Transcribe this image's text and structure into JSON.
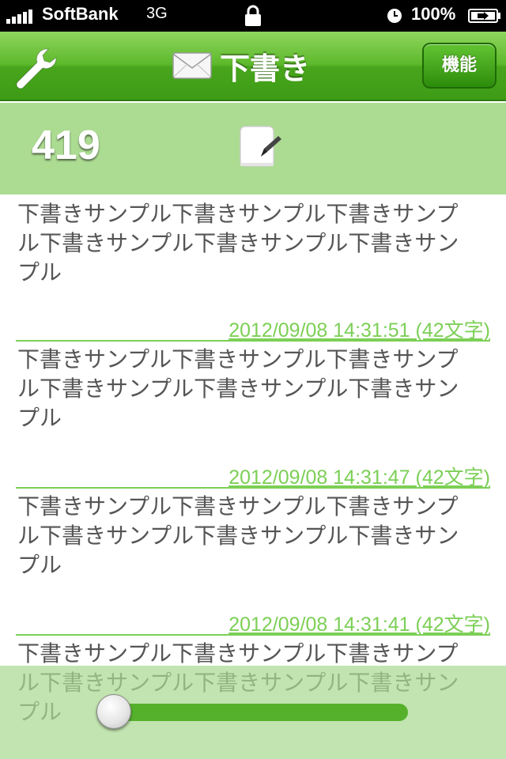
{
  "status_bar": {
    "carrier": "SoftBank",
    "network": "3G",
    "battery_percent": "100%"
  },
  "nav": {
    "title": "下書き",
    "func_button_label": "機能"
  },
  "info": {
    "draft_count": "419"
  },
  "drafts": [
    {
      "body": "下書きサンプル下書きサンプル下書きサンプル下書きサンプル下書きサンプル下書きサンプル",
      "meta": ""
    },
    {
      "body": "下書きサンプル下書きサンプル下書きサンプル下書きサンプル下書きサンプル下書きサンプル",
      "meta": "2012/09/08 14:31:51 (42文字)"
    },
    {
      "body": "下書きサンプル下書きサンプル下書きサンプル下書きサンプル下書きサンプル下書きサンプル",
      "meta": "2012/09/08 14:31:47 (42文字)"
    },
    {
      "body": "下書きサンプル下書きサンプル下書きサンプル下書きサンプル下書きサンプル下書きサンプル",
      "meta": "2012/09/08 14:31:41 (42文字)"
    }
  ],
  "slider": {
    "position": 0.0
  }
}
